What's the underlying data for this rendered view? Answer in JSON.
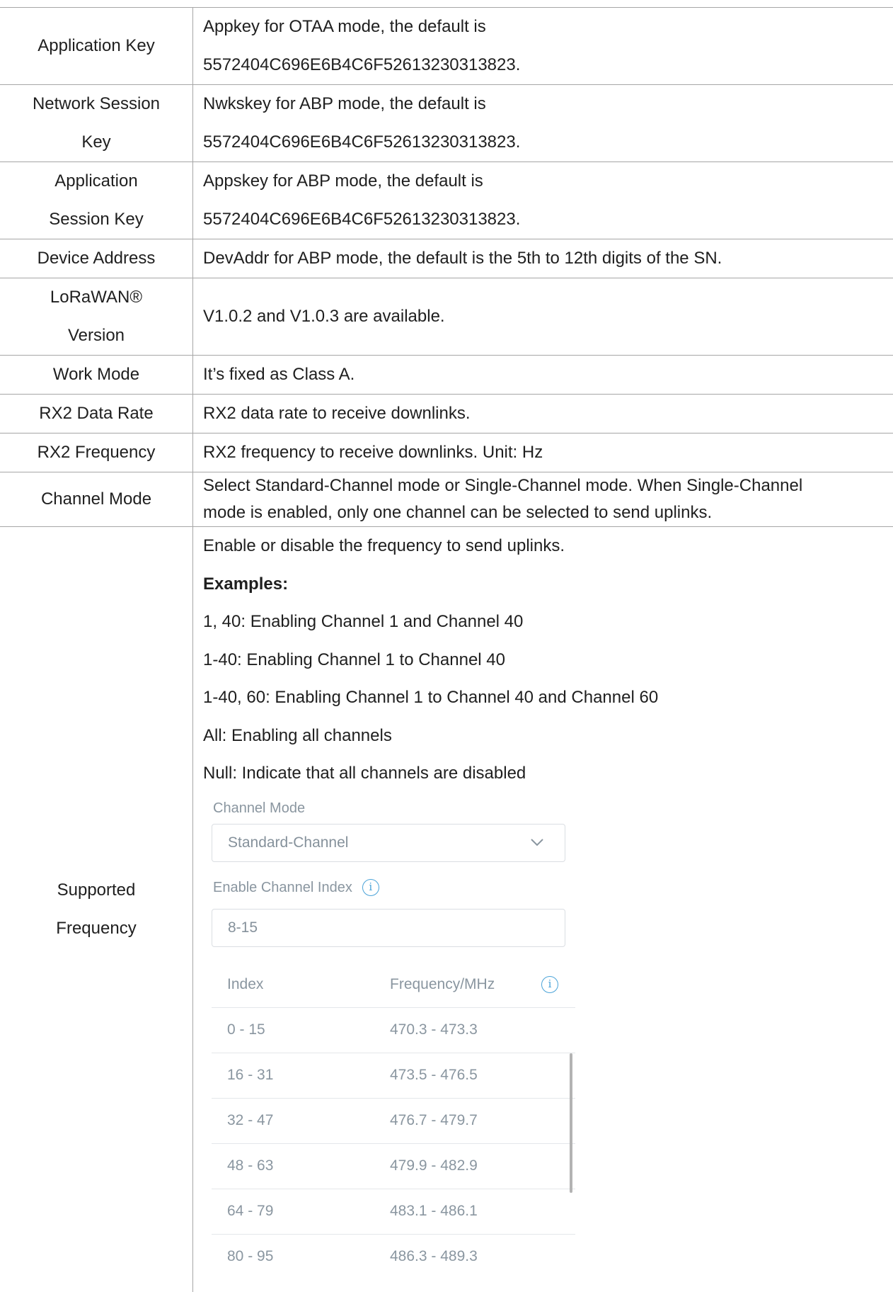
{
  "rows": [
    {
      "name": [
        "Application Key"
      ],
      "desc": [
        "Appkey for OTAA mode, the default is",
        "5572404C696E6B4C6F52613230313823."
      ]
    },
    {
      "name": [
        "Network Session",
        "Key"
      ],
      "desc": [
        "Nwkskey for ABP mode, the default is",
        "5572404C696E6B4C6F52613230313823."
      ]
    },
    {
      "name": [
        "Application",
        "Session Key"
      ],
      "desc": [
        "Appskey for ABP mode, the default is",
        "5572404C696E6B4C6F52613230313823."
      ]
    },
    {
      "name": [
        "Device Address"
      ],
      "desc": [
        "DevAddr for ABP mode, the default is the 5th to 12th digits of the SN."
      ]
    },
    {
      "name": [
        "LoRaWAN®",
        "Version"
      ],
      "desc": [
        "V1.0.2 and V1.0.3 are available."
      ]
    },
    {
      "name": [
        "Work Mode"
      ],
      "desc": [
        "It’s fixed as Class A."
      ]
    },
    {
      "name": [
        "RX2 Data Rate"
      ],
      "desc": [
        "RX2 data rate to receive downlinks."
      ]
    },
    {
      "name": [
        "RX2 Frequency"
      ],
      "desc": [
        "RX2 frequency to receive downlinks. Unit: Hz"
      ]
    },
    {
      "name": [
        "Channel Mode"
      ],
      "desc": [
        "Select Standard-Channel mode or Single-Channel mode. When Single-Channel",
        "mode is enabled, only one channel can be selected to send uplinks."
      ]
    }
  ],
  "frequency_row": {
    "name": [
      "Supported",
      "Frequency"
    ],
    "lines": [
      "Enable or disable the frequency to send uplinks.",
      "Examples:",
      "1, 40: Enabling Channel 1 and Channel 40",
      "1-40: Enabling Channel 1 to Channel 40",
      "1-40, 60: Enabling Channel 1 to Channel 40 and Channel 60",
      "All: Enabling all channels",
      "Null: Indicate that all channels are disabled"
    ],
    "ui": {
      "channel_mode_label": "Channel Mode",
      "channel_mode_value": "Standard-Channel",
      "enable_index_label": "Enable Channel Index",
      "enable_index_value": "8-15",
      "col_index": "Index",
      "col_freq": "Frequency/MHz",
      "channels": [
        {
          "index": "0 - 15",
          "freq": "470.3 - 473.3"
        },
        {
          "index": "16 - 31",
          "freq": "473.5 - 476.5"
        },
        {
          "index": "32 - 47",
          "freq": "476.7 - 479.7"
        },
        {
          "index": "48 - 63",
          "freq": "479.9 - 482.9"
        },
        {
          "index": "64 - 79",
          "freq": "483.1 - 486.1"
        },
        {
          "index": "80 - 95",
          "freq": "486.3 - 489.3"
        }
      ]
    }
  },
  "icons": {
    "info": "i",
    "chevron": "chevron-down-icon"
  }
}
